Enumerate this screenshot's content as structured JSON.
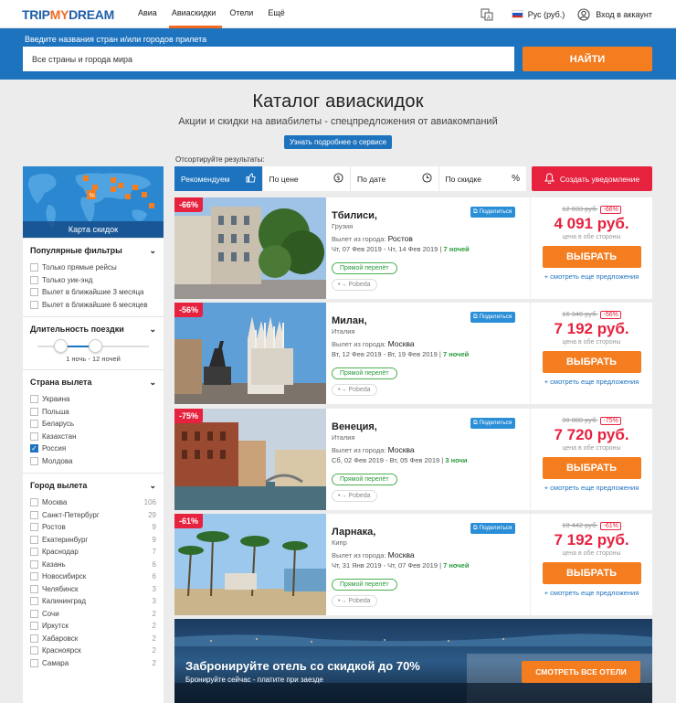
{
  "brand": {
    "logo_part1": "TRIP",
    "logo_part2": "MY",
    "logo_part3": "DREAM"
  },
  "nav": [
    {
      "label": "Авиа",
      "active": false
    },
    {
      "label": "Авиаскидки",
      "active": true
    },
    {
      "label": "Отели",
      "active": false
    },
    {
      "label": "Ещё",
      "active": false
    }
  ],
  "topright": {
    "currency": "Рус (руб.)",
    "login": "Вход в аккаунт"
  },
  "search": {
    "label": "Введите названия стран и/или городов прилета",
    "value": "Все страны и города мира",
    "button": "НАЙТИ"
  },
  "headline": {
    "title": "Каталог авиаскидок",
    "subtitle": "Акции и скидки на авиабилеты - спецпредложения от авиакомпаний",
    "more_button": "Узнать подробнее о сервисе"
  },
  "sort": {
    "label": "Отсортируйте результаты:",
    "options": [
      "Рекомендуем",
      "По цене",
      "По дате",
      "По скидке"
    ],
    "alert_button": "Создать уведомление"
  },
  "sidebar": {
    "map_caption": "Карта скидок",
    "popular": {
      "title": "Популярные фильтры",
      "items": [
        "Только прямые рейсы",
        "Только уик-энд",
        "Вылет в ближайшие 3 месяца",
        "Вылет в ближайшие 6 месяцев"
      ]
    },
    "duration": {
      "title": "Длительность поездки",
      "range": "1 ночь - 12 ночей",
      "min_frac": 0.18,
      "max_frac": 0.46
    },
    "departure_country": {
      "title": "Страна вылета",
      "items": [
        "Украина",
        "Польша",
        "Беларусь",
        "Казахстан",
        "Россия",
        "Молдова"
      ],
      "checked": "Россия"
    },
    "departure_city": {
      "title": "Город вылета",
      "items": [
        {
          "name": "Москва",
          "count": "106"
        },
        {
          "name": "Санкт-Петербург",
          "count": "29"
        },
        {
          "name": "Ростов",
          "count": "9"
        },
        {
          "name": "Екатеринбург",
          "count": "9"
        },
        {
          "name": "Краснодар",
          "count": "7"
        },
        {
          "name": "Казань",
          "count": "6"
        },
        {
          "name": "Новосибирск",
          "count": "6"
        },
        {
          "name": "Челябинск",
          "count": "3"
        },
        {
          "name": "Калининград",
          "count": "3"
        },
        {
          "name": "Сочи",
          "count": "2"
        },
        {
          "name": "Иркутск",
          "count": "2"
        },
        {
          "name": "Хабаровск",
          "count": "2"
        },
        {
          "name": "Красноярск",
          "count": "2"
        },
        {
          "name": "Самара",
          "count": "2"
        }
      ]
    }
  },
  "cards": [
    {
      "discount": "-66%",
      "city": "Тбилиси,",
      "country": "Грузия",
      "share": "Поделиться",
      "dep_label": "Вылет из города:",
      "dep_city": "Ростов",
      "dates": "Чт, 07 Фев 2019 - Чт, 14 Фев 2019 |",
      "nights": "7 ночей",
      "direct": "Прямой перелёт",
      "airline": "Pobeda",
      "old_price": "12 033 руб.",
      "pct": "-66%",
      "price": "4 091 руб.",
      "both": "цена в обе стороны",
      "select": "ВЫБРАТЬ",
      "more": "+ смотреть еще предложения"
    },
    {
      "discount": "-56%",
      "city": "Милан,",
      "country": "Италия",
      "share": "Поделиться",
      "dep_label": "Вылет из города:",
      "dep_city": "Москва",
      "dates": "Вт, 12 Фев 2019 - Вт, 19 Фев 2019 |",
      "nights": "7 ночей",
      "direct": "Прямой перелёт",
      "airline": "Pobeda",
      "old_price": "16 346 руб.",
      "pct": "-56%",
      "price": "7 192 руб.",
      "both": "цена в обе стороны",
      "select": "ВЫБРАТЬ",
      "more": "+ смотреть еще предложения"
    },
    {
      "discount": "-75%",
      "city": "Венеция,",
      "country": "Италия",
      "share": "Поделиться",
      "dep_label": "Вылет из города:",
      "dep_city": "Москва",
      "dates": "Сб, 02 Фев 2019 - Вт, 05 Фев 2019 |",
      "nights": "3 ночи",
      "direct": "Прямой перелёт",
      "airline": "Pobeda",
      "old_price": "30 880 руб.",
      "pct": "-75%",
      "price": "7 720 руб.",
      "both": "цена в обе стороны",
      "select": "ВЫБРАТЬ",
      "more": "+ смотреть еще предложения"
    },
    {
      "discount": "-61%",
      "city": "Ларнака,",
      "country": "Кипр",
      "share": "Поделиться",
      "dep_label": "Вылет из города:",
      "dep_city": "Москва",
      "dates": "Чт, 31 Янв 2019 - Чт, 07 Фев 2019 |",
      "nights": "7 ночей",
      "direct": "Прямой перелёт",
      "airline": "Pobeda",
      "old_price": "18 442 руб.",
      "pct": "-61%",
      "price": "7 192 руб.",
      "both": "цена в обе стороны",
      "select": "ВЫБРАТЬ",
      "more": "+ смотреть еще предложения"
    }
  ],
  "hotel_banner": {
    "title": "Забронируйте отель со скидкой до 70%",
    "subtitle": "Бронируйте сейчас - платите при заезде",
    "button": "СМОТРЕТЬ ВСЕ ОТЕЛИ"
  },
  "colors": {
    "primary": "#1e73be",
    "accent": "#f47d20",
    "sale": "#e6223f",
    "success": "#2a9a3c"
  }
}
